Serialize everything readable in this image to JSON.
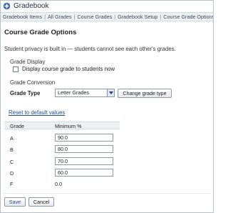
{
  "app": {
    "title": "Gradebook",
    "icon": "gradebook-icon"
  },
  "nav": {
    "items": [
      "Gradebook Items",
      "All Grades",
      "Course Grades",
      "Gradebook Setup",
      "Course Grade Options"
    ]
  },
  "page": {
    "title": "Course Grade Options",
    "privacy_text": "Student privacy is built in — students cannot see each other's grades."
  },
  "grade_display": {
    "heading": "Grade Display",
    "checkbox_label": "Display course grade to students now",
    "checked": false
  },
  "grade_conversion": {
    "heading": "Grade Conversion",
    "grade_type_label": "Grade Type",
    "grade_type_value": "Letter Grades",
    "change_button": "Change grade type",
    "reset_link": "Reset to default values"
  },
  "table": {
    "headers": {
      "grade": "Grade",
      "minimum": "Minimum %"
    },
    "rows": [
      {
        "grade": "A",
        "minimum": "90.0"
      },
      {
        "grade": "B",
        "minimum": "80.0"
      },
      {
        "grade": "C",
        "minimum": "70.0"
      },
      {
        "grade": "D",
        "minimum": "60.0"
      },
      {
        "grade": "F",
        "minimum": "0.0"
      }
    ]
  },
  "footer": {
    "save": "Save",
    "cancel": "Cancel"
  },
  "colors": {
    "link": "#1f4f99",
    "header_bg": "#eef1f4",
    "border": "#8a9aab"
  }
}
